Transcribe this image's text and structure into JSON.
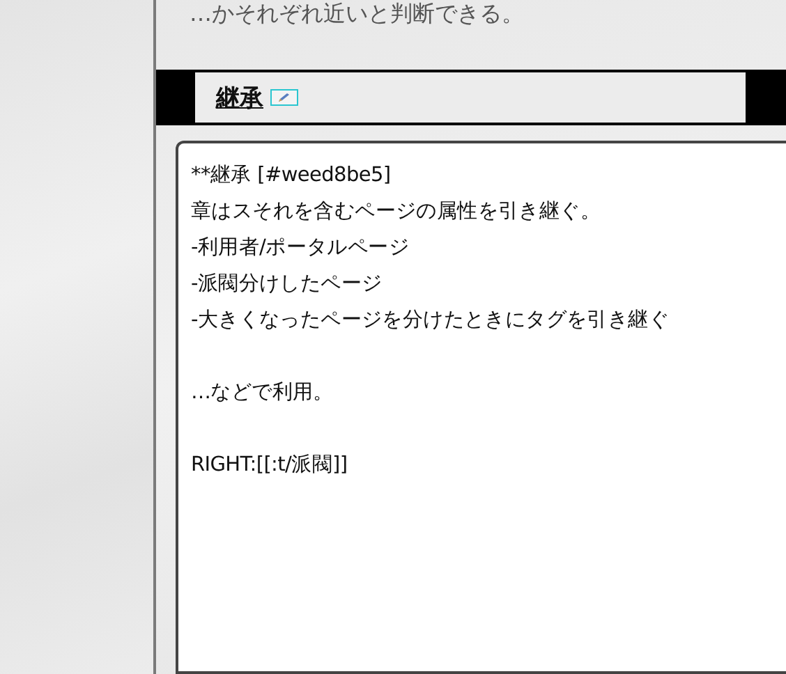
{
  "intro_text": "…かそれぞれ近いと判断できる。",
  "section": {
    "heading": "継承",
    "editable": true
  },
  "editor": {
    "paragraphs": [
      [
        "**継承 [#weed8be5]",
        "章はスそれを含むページの属性を引き継ぐ。",
        "-利用者/ポータルページ",
        "-派閥分けしたページ",
        "-大きくなったページを分けたときにタグを引き継ぐ"
      ],
      [
        "…などで利用。"
      ],
      [
        "RIGHT:[[:t/派閥]]"
      ]
    ]
  }
}
